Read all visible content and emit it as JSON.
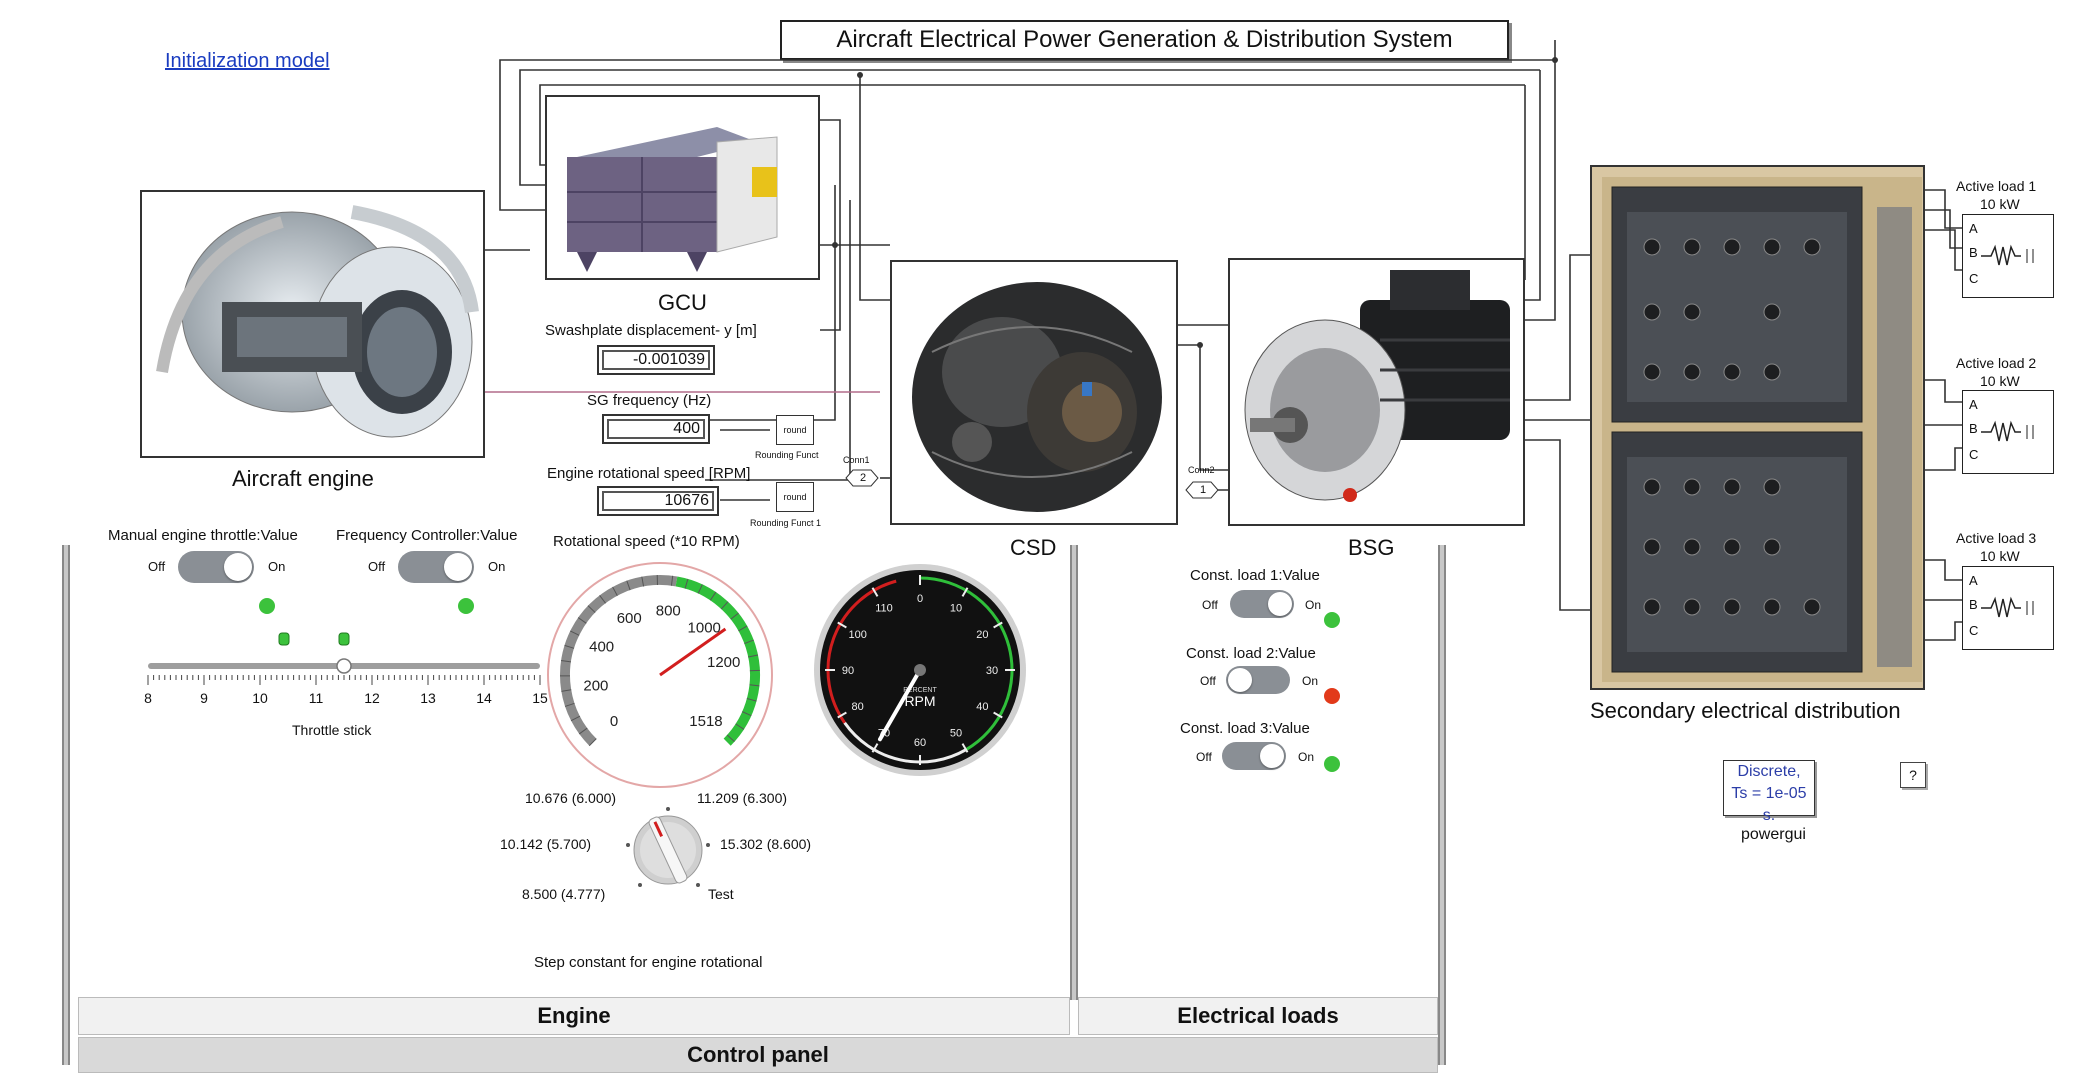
{
  "title": "Aircraft Electrical Power Generation & Distribution System",
  "init_link": "Initialization model",
  "blocks": {
    "gcu": "GCU",
    "engine": "Aircraft engine",
    "csd": "CSD",
    "bsg": "BSG",
    "secondary": "Secondary electrical distribution"
  },
  "displays": {
    "swash_label": "Swashplate displacement- y [m]",
    "swash_value": "-0.001039",
    "sg_label": "SG frequency (Hz)",
    "sg_value": "400",
    "eng_label": "Engine rotational speed [RPM]",
    "eng_value": "10676"
  },
  "small": {
    "round1": "round",
    "round1_label": "Rounding Funct",
    "round2": "round",
    "round2_label": "Rounding Funct 1",
    "conn1_label": "Conn1",
    "conn1_num": "2",
    "conn2_label": "Conn2",
    "conn2_num": "1"
  },
  "loads": {
    "l1": "Active load 1",
    "l2": "Active load 2",
    "l3": "Active load 3",
    "power": "10 kW",
    "a": "A",
    "b": "B",
    "c": "C"
  },
  "controls": {
    "manual_label": "Manual engine throttle:Value",
    "freq_label": "Frequency Controller:Value",
    "off": "Off",
    "on": "On",
    "throttle_label": "Throttle stick",
    "throttle_ticks": [
      "8",
      "9",
      "10",
      "11",
      "12",
      "13",
      "14",
      "15"
    ],
    "throttle_value": 11.5,
    "gauge_label": "Rotational speed (*10 RPM)",
    "gauge_ticks": [
      "0",
      "200",
      "400",
      "600",
      "800",
      "1000",
      "1200",
      "1518"
    ],
    "rpm_ticks": [
      "0",
      "10",
      "20",
      "30",
      "40",
      "50",
      "60",
      "70",
      "80",
      "90",
      "100",
      "110"
    ],
    "rpm_small_label": "PERCENT",
    "rpm_label": "RPM",
    "knob_opts": [
      "10.676 (6.000)",
      "11.209 (6.300)",
      "10.142 (5.700)",
      "15.302 (8.600)",
      "8.500 (4.777)",
      "Test"
    ],
    "knob_label": "Step constant for engine rotational",
    "load1_label": "Const. load 1:Value",
    "load2_label": "Const. load 2:Value",
    "load3_label": "Const. load 3:Value"
  },
  "panels": {
    "engine": "Engine",
    "elec": "Electrical loads",
    "control": "Control panel"
  },
  "powergui": {
    "line1": "Discrete,",
    "line2": "Ts = 1e-05 s.",
    "label": "powergui",
    "help": "?"
  },
  "colors": {
    "led_green": "#3cc23c",
    "led_red": "#e23a1a",
    "link": "#1a3cc0",
    "gauge_green": "#2fbf3a",
    "gauge_red": "#d21e1e"
  }
}
